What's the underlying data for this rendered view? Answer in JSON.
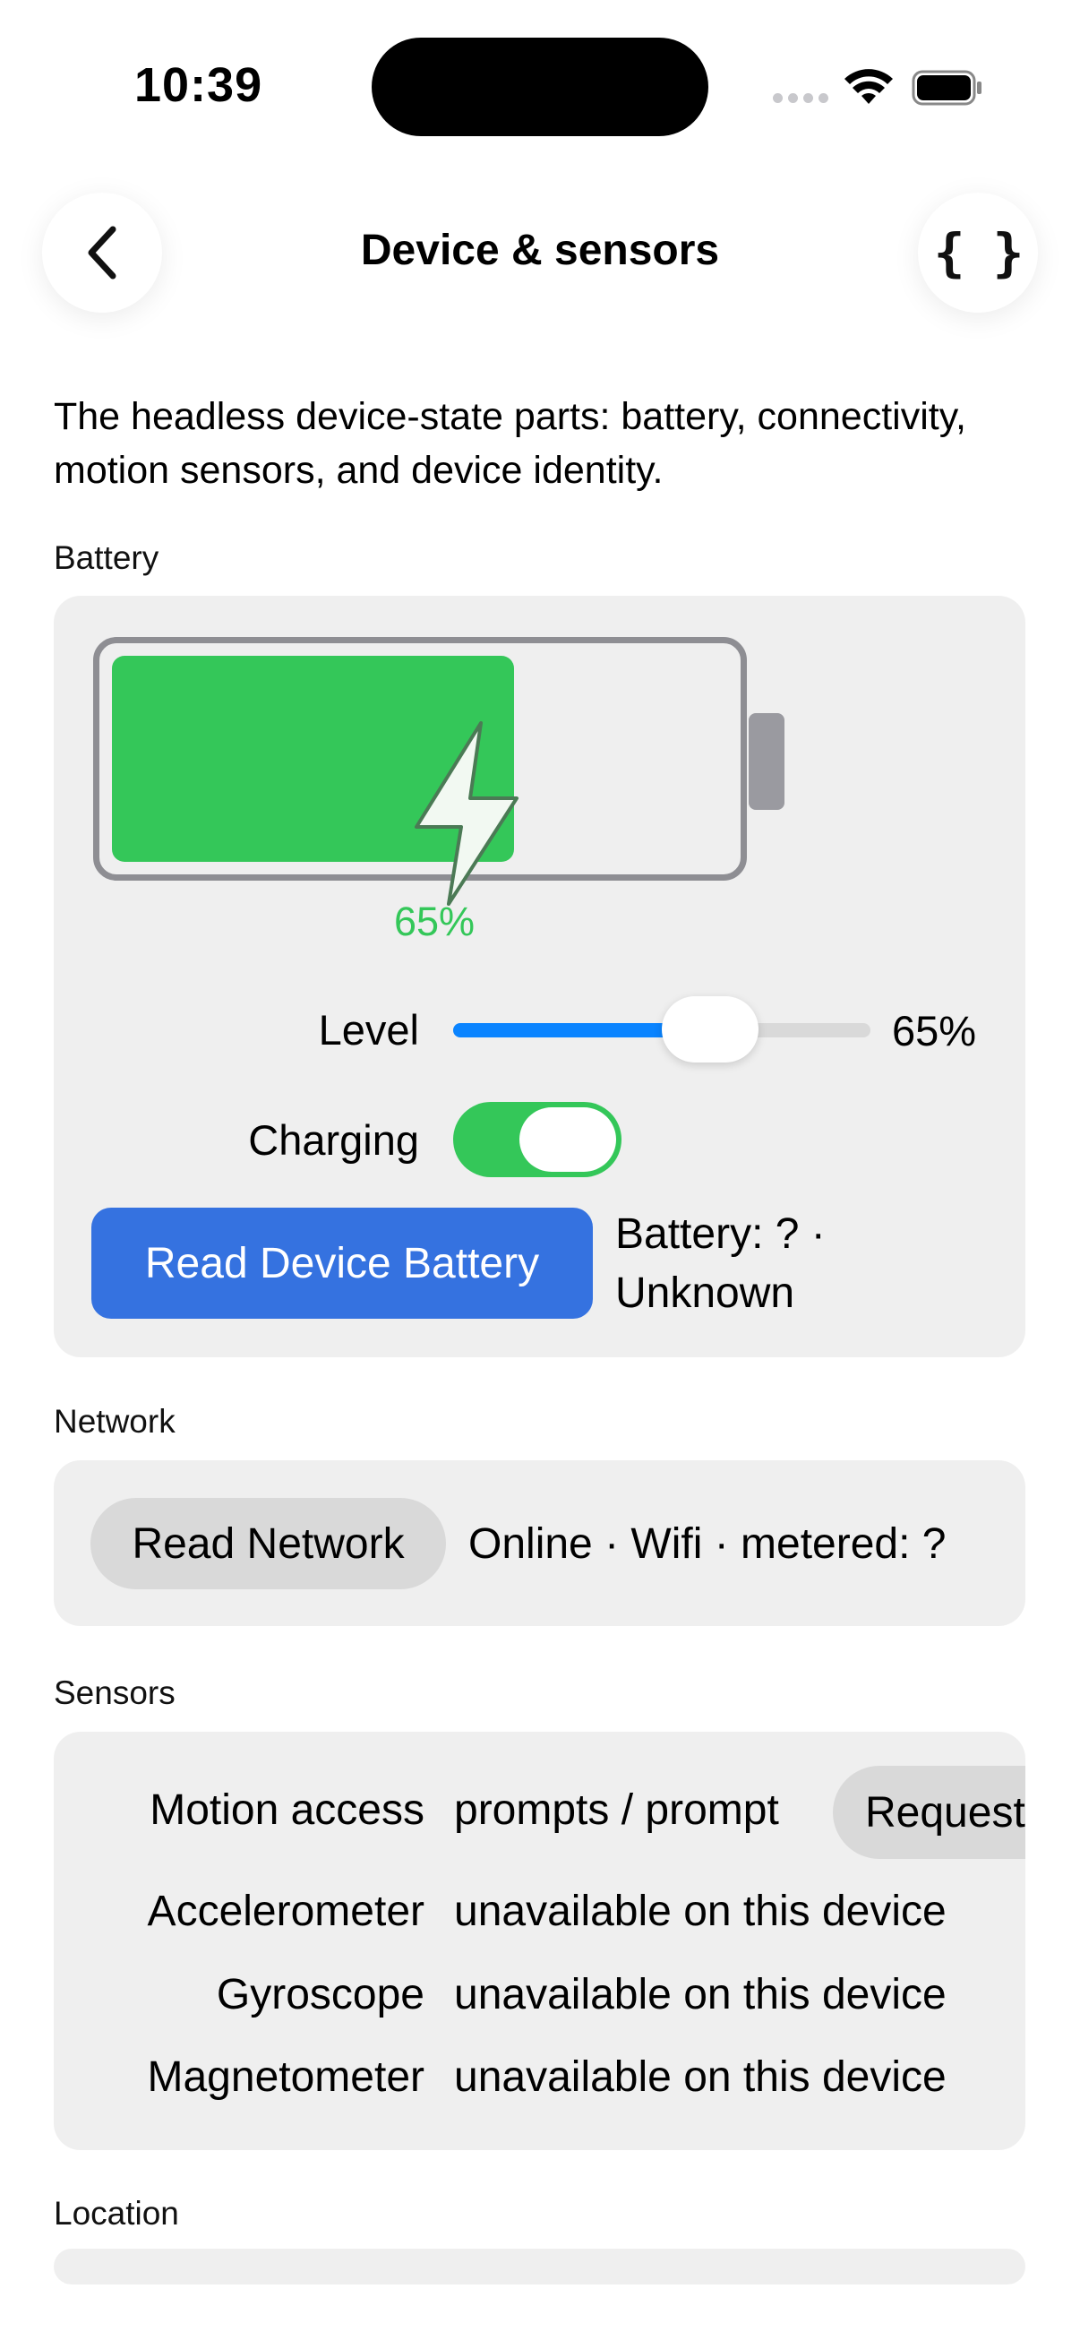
{
  "status_bar": {
    "time": "10:39"
  },
  "nav": {
    "title": "Device & sensors",
    "back_icon": "chevron-left-icon",
    "code_icon": "curly-braces-icon",
    "code_glyph": "{ }"
  },
  "intro": "The headless device-state parts: battery, connectivity, motion sensors, and device identity.",
  "battery": {
    "section_label": "Battery",
    "level_percent": 65,
    "level_display": "65%",
    "level_label": "Level",
    "slider_value_display": "65%",
    "charging_label": "Charging",
    "charging": true,
    "read_button": "Read Device Battery",
    "status_text": "Battery: ? · Unknown",
    "colors": {
      "fill": "#34c759",
      "button": "#3572e0",
      "slider": "#0a84ff"
    }
  },
  "network": {
    "section_label": "Network",
    "read_button": "Read Network",
    "status_text": "Online · Wifi · metered: ?"
  },
  "sensors": {
    "section_label": "Sensors",
    "rows": [
      {
        "label": "Motion access",
        "value": "prompts / prompt"
      },
      {
        "label": "Accelerometer",
        "value": "unavailable on this device"
      },
      {
        "label": "Gyroscope",
        "value": "unavailable on this device"
      },
      {
        "label": "Magnetometer",
        "value": "unavailable on this device"
      }
    ],
    "request_button": "Request"
  },
  "location": {
    "section_label": "Location"
  }
}
